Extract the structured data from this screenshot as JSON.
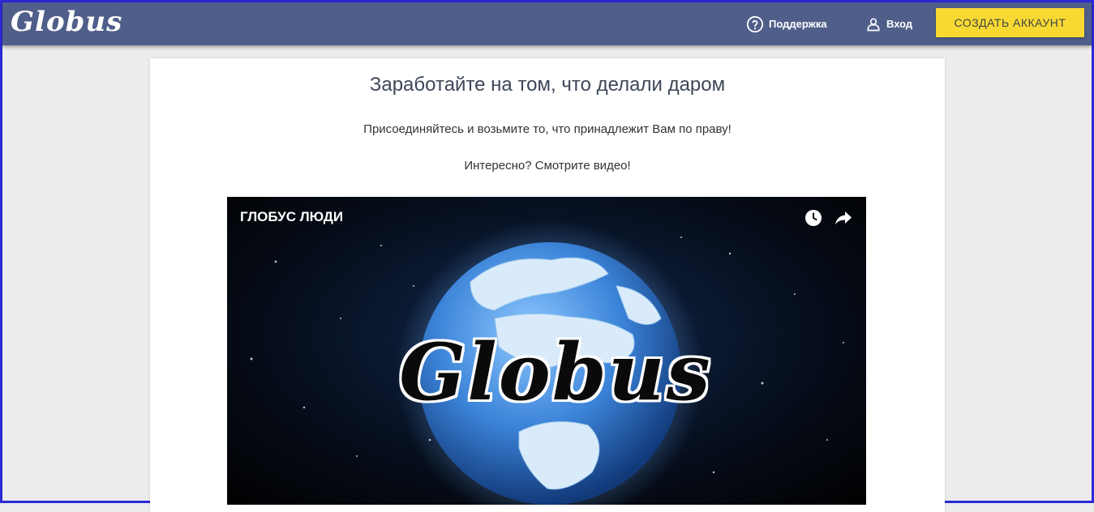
{
  "header": {
    "logo": "Globus",
    "support_label": "Поддержка",
    "login_label": "Вход",
    "cta_label": "СОЗДАТЬ АККАУНТ",
    "background_color": "#505e8a",
    "cta_color": "#f7d932"
  },
  "main": {
    "headline": "Заработайте на том, что делали даром",
    "subtitle": "Присоединяйтесь и возьмите то, что принадлежит Вам по праву!",
    "prompt": "Интересно? Смотрите видео!"
  },
  "video": {
    "title": "ГЛОБУС ЛЮДИ",
    "logo_text": "Globus",
    "icons": [
      "clock-icon",
      "share-icon"
    ]
  }
}
